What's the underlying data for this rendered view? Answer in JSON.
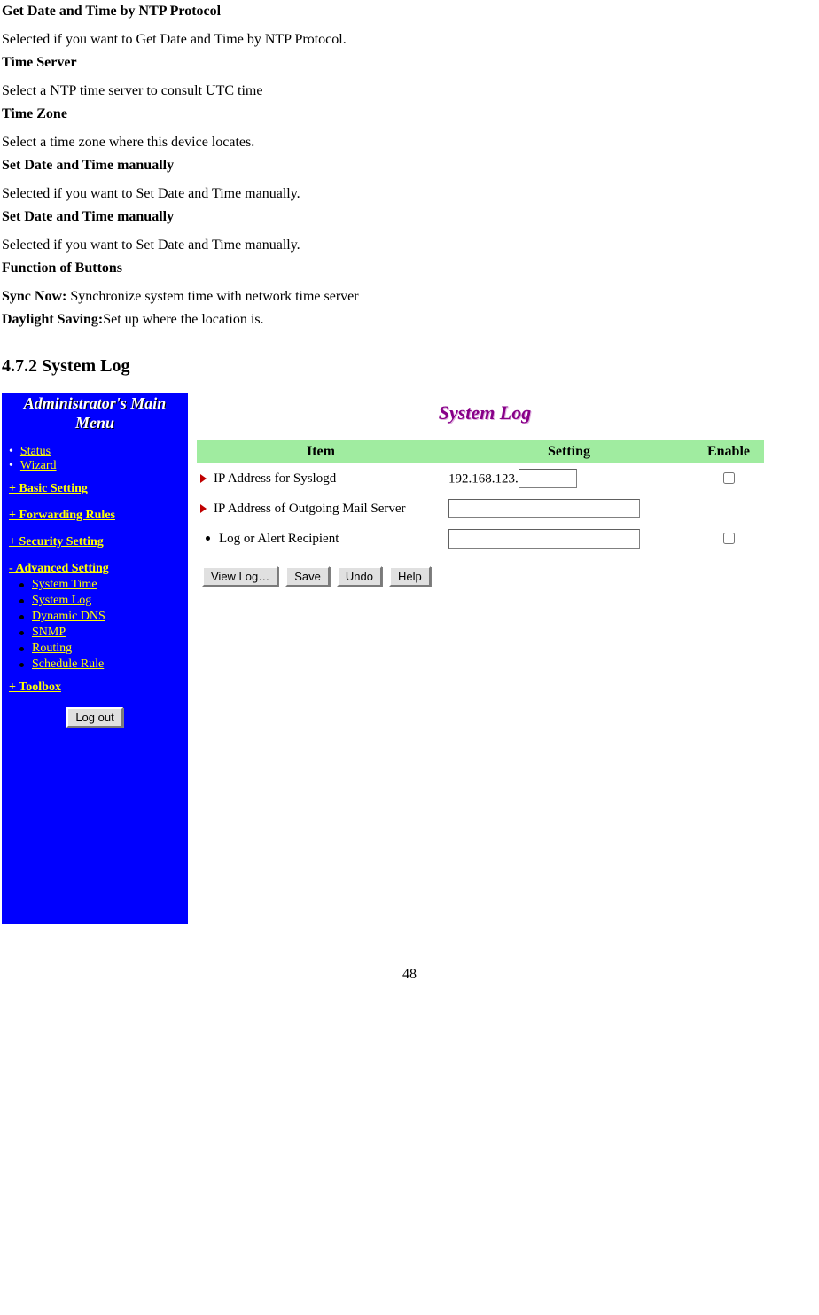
{
  "doc": {
    "h1": "Get Date and Time by NTP Protocol",
    "p1": "Selected if you want to Get Date and Time by NTP Protocol.",
    "h2": "Time Server",
    "p2": "Select a NTP time server to consult UTC time",
    "h3": "Time Zone",
    "p3": "Select a time zone where this device locates.",
    "h4": "Set Date and Time manually",
    "p4": "Selected if you want to Set Date and Time manually.",
    "h5": "Set Date and Time manually",
    "p5": "Selected if you want to Set Date and Time manually.",
    "h6": "Function of Buttons",
    "sync_label": "Sync Now: ",
    "sync_text": "Synchronize system time with network time server",
    "dst_label": "Daylight Saving:",
    "dst_text": "Set up where the location is.",
    "section": "4.7.2 System Log"
  },
  "router": {
    "sidebar": {
      "title1": "Administrator's Main",
      "title2": "Menu",
      "top_links": [
        "Status",
        "Wizard"
      ],
      "groups": [
        "+ Basic Setting",
        "+ Forwarding Rules",
        "+ Security Setting",
        "- Advanced Setting"
      ],
      "sub_items": [
        "System Time",
        "System Log",
        "Dynamic DNS",
        "SNMP",
        "Routing",
        "Schedule Rule"
      ],
      "toolbox": "+ Toolbox",
      "logout": "Log out"
    },
    "content": {
      "title": "System Log",
      "headers": {
        "item": "Item",
        "setting": "Setting",
        "enable": "Enable"
      },
      "rows": {
        "r1_label": "IP Address for Syslogd",
        "r1_prefix": "192.168.123.",
        "r1_value": "",
        "r2_label": "IP Address of Outgoing Mail Server",
        "r2_value": "",
        "r3_label": "Log or Alert Recipient",
        "r3_value": ""
      },
      "buttons": {
        "view": "View Log…",
        "save": "Save",
        "undo": "Undo",
        "help": "Help"
      }
    }
  },
  "page_number": "48"
}
